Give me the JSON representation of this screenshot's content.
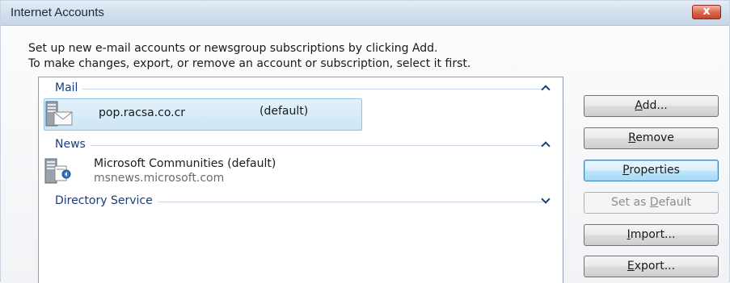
{
  "window": {
    "title": "Internet Accounts",
    "close_label": "x"
  },
  "instructions": {
    "line1": "Set up new e-mail accounts or newsgroup subscriptions by clicking Add.",
    "line2": "To make changes, export, or remove an account or subscription, select it first."
  },
  "groups": [
    {
      "label": "Mail",
      "state": "expanded",
      "accounts": [
        {
          "name": "pop.racsa.co.cr",
          "default_text": "(default)",
          "selected": true,
          "icon": "mail-server-icon"
        }
      ]
    },
    {
      "label": "News",
      "state": "expanded",
      "accounts": [
        {
          "name": "Microsoft Communities (default)",
          "sub": "msnews.microsoft.com",
          "selected": false,
          "icon": "news-server-icon"
        }
      ]
    },
    {
      "label": "Directory Service",
      "state": "collapsed",
      "accounts": []
    }
  ],
  "buttons": {
    "add": {
      "pre": "",
      "key": "A",
      "post": "dd..."
    },
    "remove": {
      "pre": "",
      "key": "R",
      "post": "emove"
    },
    "properties": {
      "pre": "",
      "key": "P",
      "post": "roperties"
    },
    "set_default": {
      "pre": "Set as ",
      "key": "D",
      "post": "efault"
    },
    "import": {
      "pre": "",
      "key": "I",
      "post": "mport..."
    },
    "export": {
      "pre": "",
      "key": "E",
      "post": "xport..."
    }
  },
  "colors": {
    "group_label": "#1e3c78",
    "selection": "#cde6f7",
    "titlebar": "#d4e0ee",
    "close": "#c7442b"
  }
}
